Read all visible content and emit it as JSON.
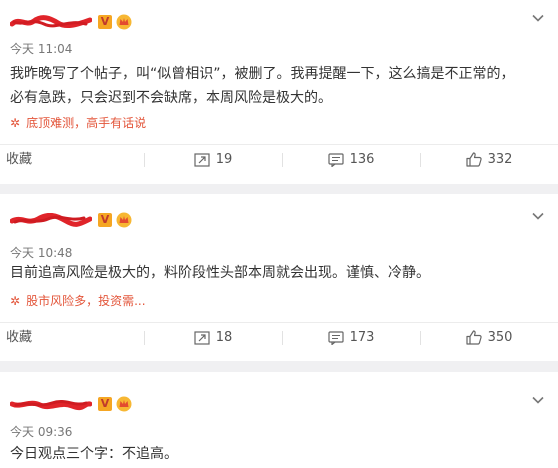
{
  "posts": [
    {
      "time": "今天 11:04",
      "content_line1": "我昨晚写了个帖子，叫“似曾相识”，被删了。我再提醒一下，这么搞是不正常的，",
      "content_line2": "必有急跌，只会迟到不会缺席，本周风险是极大的。",
      "source": "底顶难测，高手有话说",
      "actions": {
        "favorite": "收藏",
        "repost": "19",
        "comment": "136",
        "like": "332"
      }
    },
    {
      "time": "今天 10:48",
      "content_line1": "目前追高风险是极大的，料阶段性头部本周就会出现。谨慎、冷静。",
      "source": "股市风险多，投资需...",
      "actions": {
        "favorite": "收藏",
        "repost": "18",
        "comment": "173",
        "like": "350"
      }
    },
    {
      "time": "今天 09:36",
      "content_line1": "今日观点三个字：不追高。"
    }
  ],
  "icons": {
    "verified": "verified-v-icon",
    "crown": "crown-icon",
    "more": "chevron-down-icon",
    "source": "asterisk-icon",
    "repost": "repost-icon",
    "comment": "comment-icon",
    "like": "thumbs-up-icon"
  },
  "colors": {
    "accent": "#e3553a",
    "text": "#333333",
    "muted": "#777777",
    "redacted": "#e0242a"
  }
}
